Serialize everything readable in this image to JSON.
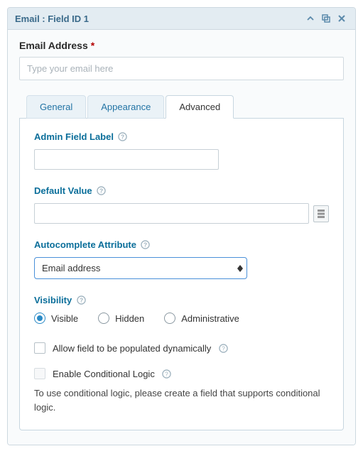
{
  "panel": {
    "title": "Email : Field ID 1"
  },
  "field": {
    "label": "Email Address",
    "required_mark": "*",
    "placeholder": "Type your email here"
  },
  "tabs": {
    "general": "General",
    "appearance": "Appearance",
    "advanced": "Advanced"
  },
  "settings": {
    "admin_field_label": "Admin Field Label",
    "default_value": "Default Value",
    "autocomplete_attribute": "Autocomplete Attribute",
    "autocomplete_value": "Email address",
    "visibility": "Visibility",
    "visibility_options": {
      "visible": "Visible",
      "hidden": "Hidden",
      "administrative": "Administrative"
    },
    "allow_dynamic": "Allow field to be populated dynamically",
    "enable_conditional": "Enable Conditional Logic",
    "conditional_note": "To use conditional logic, please create a field that supports conditional logic."
  }
}
